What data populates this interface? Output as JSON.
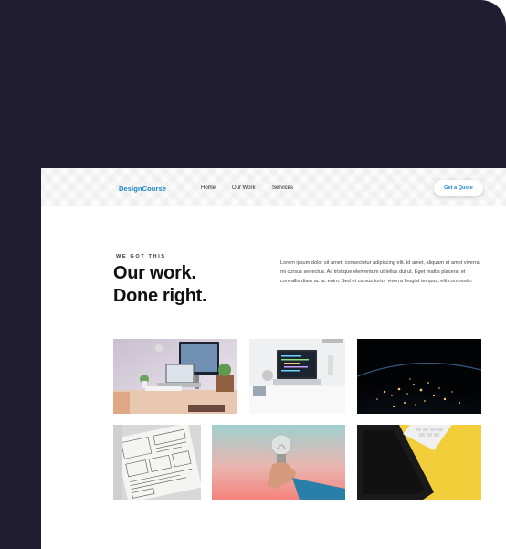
{
  "nav": {
    "logo": "DesignCourse",
    "links": [
      "Home",
      "Our Work",
      "Services"
    ],
    "cta": "Get a Quote"
  },
  "hero": {
    "eyebrow": "WE GOT THIS",
    "headline_line1": "Our work.",
    "headline_line2": "Done right.",
    "paragraph": "Lorem ipsum dolor sit amet, consectetur adipiscing elit. Id amet, aliquam et amet viverra mi cursus senectus. Ac tristique elementum ut tellus dui ut. Eget mattis placerat et convallis diam ac ac enim. Sed et cursus tortor viverra feugiat tempus, elit commodo."
  },
  "gallery": [
    {
      "subject": "desk-workspace-photo"
    },
    {
      "subject": "laptop-code-photo"
    },
    {
      "subject": "earth-night-photo"
    },
    {
      "subject": "wireframe-sketch-photo"
    },
    {
      "subject": "lightbulb-hand-photo"
    },
    {
      "subject": "tablet-keyboard-yellow-photo"
    }
  ],
  "colors": {
    "frame": "#1f1d2f",
    "brand": "#1a86c9",
    "text": "#111111"
  }
}
